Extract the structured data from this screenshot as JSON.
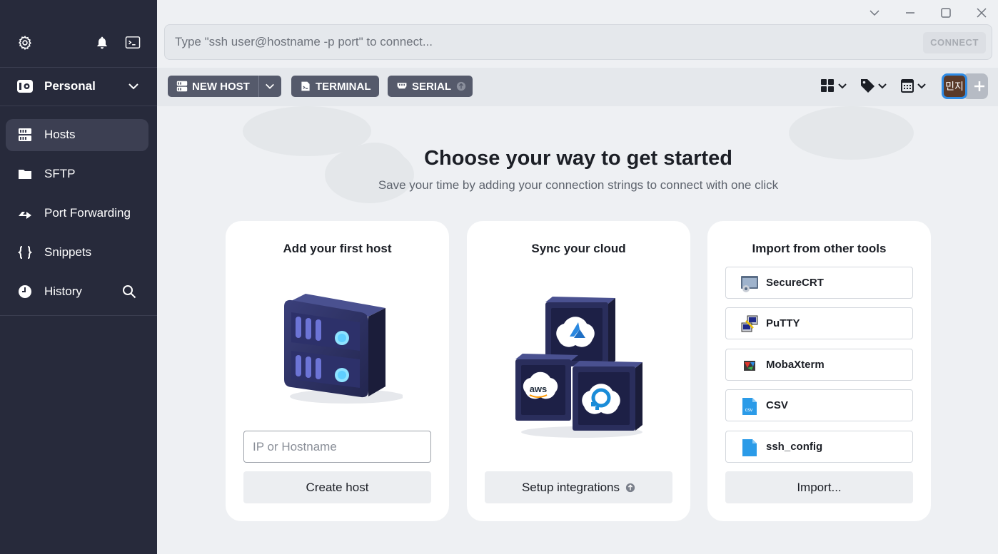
{
  "sidebar": {
    "vault_name": "Personal",
    "items": [
      {
        "label": "Hosts",
        "icon": "hosts-icon"
      },
      {
        "label": "SFTP",
        "icon": "folder-icon"
      },
      {
        "label": "Port Forwarding",
        "icon": "port-forward-icon"
      },
      {
        "label": "Snippets",
        "icon": "braces-icon"
      },
      {
        "label": "History",
        "icon": "clock-icon"
      }
    ]
  },
  "search": {
    "placeholder": "Type \"ssh user@hostname -p port\" to connect...",
    "connect_label": "CONNECT"
  },
  "toolbar": {
    "new_host_label": "NEW HOST",
    "terminal_label": "TERMINAL",
    "serial_label": "SERIAL",
    "avatar_text": "민지"
  },
  "main": {
    "headline": "Choose your way to get started",
    "subline": "Save your time by adding your connection strings to connect with one click",
    "cards": {
      "host": {
        "title": "Add your first host",
        "input_placeholder": "IP or Hostname",
        "button_label": "Create host"
      },
      "cloud": {
        "title": "Sync your cloud",
        "button_label": "Setup integrations",
        "providers": [
          "aws"
        ]
      },
      "import": {
        "title": "Import from other tools",
        "tools": [
          {
            "label": "SecureCRT",
            "icon": "securecrt-icon"
          },
          {
            "label": "PuTTY",
            "icon": "putty-icon"
          },
          {
            "label": "MobaXterm",
            "icon": "mobaxterm-icon"
          },
          {
            "label": "CSV",
            "icon": "csv-file-icon"
          },
          {
            "label": "ssh_config",
            "icon": "file-icon"
          }
        ],
        "button_label": "Import..."
      }
    }
  },
  "colors": {
    "sidebar_bg": "#272a3b",
    "accent_blue": "#2f8ce6",
    "button_dark": "#555a6b"
  }
}
